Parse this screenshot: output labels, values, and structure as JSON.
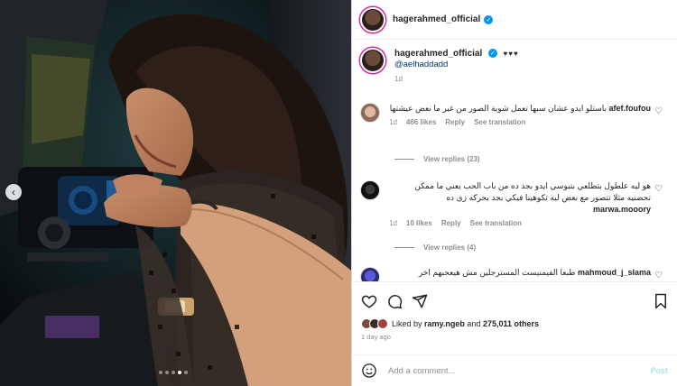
{
  "post": {
    "username": "hagerahmed_official",
    "caption_hearts": "♥♥♥",
    "caption_mention": "@aelhaddadd",
    "caption_age": "1d",
    "likes_prefix": "Liked by",
    "likes_user": "ramy.ngeb",
    "likes_and": "and",
    "likes_count": "275,011 others",
    "posted_ago": "1 day ago",
    "add_comment_placeholder": "Add a comment...",
    "post_label": "Post"
  },
  "comments": [
    {
      "user": "afef.foufou",
      "text": "باستلو ايدو عشان سبها تعمل شوية الصور من غير ما نعض عيشتها",
      "age": "1d",
      "likes": "466 likes",
      "reply": "Reply",
      "translate": "See translation",
      "view_replies": "View replies (23)"
    },
    {
      "user": "marwa.mooory",
      "text": "هو ليه علطول بتطلعي بتبوسي ايدو بجد ده من باب الحب يعني ما ممكن تحضنيه مثلا تتصور مع بعض ليه تكوهينا فيكي بجد بحركه زي ده",
      "age": "1d",
      "likes": "10 likes",
      "reply": "Reply",
      "translate": "See translation",
      "view_replies": "View replies (4)"
    },
    {
      "user": "mahmoud_j_slama",
      "text": "طبعا الفيمنيست المسترجلين مش هيعجبهم اخر"
    }
  ],
  "carousel": {
    "slides": 5,
    "active_index": 3
  },
  "icons": {
    "like": "heart-icon",
    "comment": "comment-icon",
    "share": "send-icon",
    "save": "bookmark-icon",
    "emoji": "emoji-icon",
    "prev": "chevron-left-icon",
    "verified": "verified-badge-icon"
  },
  "colors": {
    "verified": "#0095f6",
    "link": "#00376b",
    "muted": "#8e8e8e",
    "post_disabled": "#b2dffc"
  }
}
